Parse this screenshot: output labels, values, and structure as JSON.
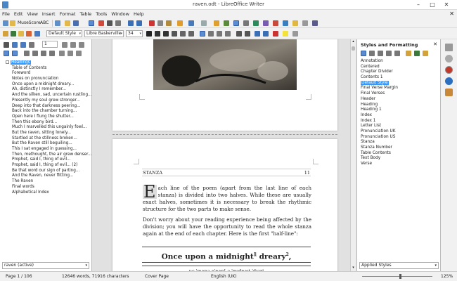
{
  "window": {
    "title": "raven.odt - LibreOffice Writer",
    "minimize": "–",
    "maximize": "□",
    "close": "✕"
  },
  "menu": [
    "File",
    "Edit",
    "View",
    "Insert",
    "Format",
    "Table",
    "Tools",
    "Window",
    "Help"
  ],
  "menu_close_doc": "✕",
  "toolbar1": {
    "font_name_1": "MuseScore",
    "font_name_2": "ABC"
  },
  "toolbar2": {
    "para_style": "Default Style",
    "font_name": "Libre Baskerville",
    "font_size": "34"
  },
  "navigator": {
    "spin_value": "1",
    "tree_root": "Headings",
    "items": [
      "Table of Contents",
      "Foreword",
      "Notes on pronunciation",
      "Once upon a midnight dreary...",
      "Ah, distinctly I remember...",
      "And the silken, sad, uncertain rustling...",
      "Presently my soul grew stronger...",
      "Deep into that darkness peering...",
      "Back into the chamber turning...",
      "Open here I flung the shutter...",
      "Then this ebony bird...",
      "Much I marvelled this ungainly fowl...",
      "But the raven, sitting lonely...",
      "Startled at the stillness broken...",
      "But the Raven still beguiling...",
      "This I sat engaged in guessing...",
      "Then, methought, the air grew denser...",
      "Prophet, said I, thing of evil...",
      "Prophet, said I, thing of evil... (2)",
      "Be that word our sign of parting...",
      "And the Raven, never flitting...",
      "The Raven",
      "Final words",
      "Alphabetical Index"
    ],
    "document_select": "raven (active)"
  },
  "document": {
    "stanza_label": "STANZA",
    "stanza_num": "11",
    "dropcap": "E",
    "para1": "ach line of the poem (apart from the last line of each stanza) is divided into two halves. While these are usually exact halves, sometimes it is necessary to break the rhythmic structure for the two parts to make sense.",
    "para2": "Don't worry about your reading experience being affected by the division; you will have the opportunity to read the whole stanza again at the end of each chapter. Here is the first \"half-line\":",
    "heading_text": "Once upon a midnight",
    "heading_sup": "1",
    "heading_text2": "dreary",
    "heading_sup2": "2",
    "heading_end": ",",
    "pron_partial": "uc  'manə a'nan! ə 'mɪdnaɪt 'dɪəri"
  },
  "styles": {
    "header": "Styles and Formatting",
    "items": [
      "Annotation",
      "Centered",
      "Chapter Divider",
      "Contents 1",
      "Default Style",
      "Final Verse Margin",
      "Final Verses",
      "Header",
      "Heading",
      "Heading 1",
      "Index",
      "Index 1",
      "Letter List",
      "Pronunciation UK",
      "Pronunciation US",
      "Stanza",
      "Stanza Number",
      "Table Contents",
      "Text Body",
      "Verse"
    ],
    "selected": "Default Style",
    "filter": "Applied Styles"
  },
  "status": {
    "page": "Page 1 / 106",
    "words": "12646 words, 71916 characters",
    "page_style": "Cover Page",
    "language": "English (UK)",
    "zoom": "125%"
  },
  "colors": {
    "selection": "#3399ff",
    "ruler_sep": "#9b8fb3"
  }
}
